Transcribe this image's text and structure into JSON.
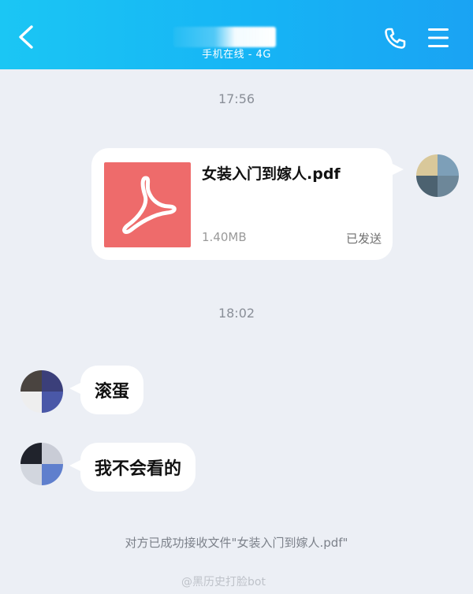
{
  "header": {
    "status": "手机在线 - 4G",
    "back_icon": "chevron-left-icon",
    "phone_icon": "phone-icon",
    "menu_icon": "menu-icon",
    "bg_color": "#1bb8f4"
  },
  "messages": {
    "time_1": "17:56",
    "file": {
      "name": "女装入门到嫁人.pdf",
      "size": "1.40MB",
      "status": "已发送",
      "icon": "pdf-icon",
      "icon_color": "#ee6b6b"
    },
    "time_2": "18:02",
    "reply_1": "滚蛋",
    "reply_2": "我不会看的"
  },
  "system_note": "对方已成功接收文件\"女装入门到嫁人.pdf\"",
  "watermark": "@黑历史打脸bot"
}
